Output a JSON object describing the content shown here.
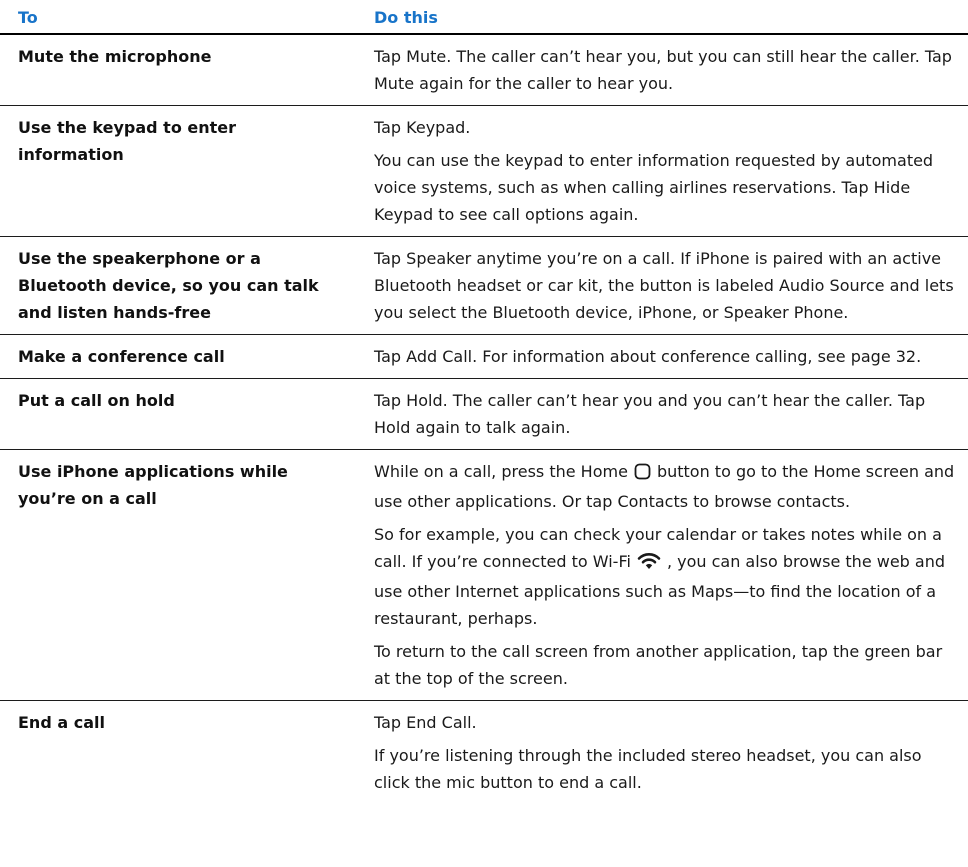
{
  "header": {
    "col_to": "To",
    "col_do": "Do this"
  },
  "rows": [
    {
      "to": "Mute the microphone",
      "do": [
        "Tap Mute. The caller can’t hear you, but you can still hear the caller. Tap Mute again for the caller to hear you."
      ]
    },
    {
      "to": "Use the keypad to enter information",
      "do": [
        "Tap Keypad.",
        "You can use the keypad to enter information requested by automated voice systems, such as when calling airlines reservations. Tap Hide Keypad to see call options again."
      ]
    },
    {
      "to": "Use the speakerphone or a Bluetooth device, so you can talk and listen hands-free",
      "do": [
        "Tap Speaker anytime you’re on a call. If iPhone is paired with an active Bluetooth headset or car kit, the button is labeled Audio Source and lets you select the Bluetooth device, iPhone, or Speaker Phone."
      ]
    },
    {
      "to": "Make a conference call",
      "do": [
        "Tap Add Call. For information about conference calling, see page 32."
      ]
    },
    {
      "to": "Put a call on hold",
      "do": [
        "Tap Hold. The caller can’t hear you and you can’t hear the caller. Tap Hold again to talk again."
      ]
    },
    {
      "to": "Use iPhone applications while you’re on a call",
      "do_p1_a": "While on a call, press the Home",
      "do_p1_b": "button to go to the Home screen and use other applications. Or tap Contacts to browse contacts.",
      "do_p2_a": "So for example, you can check your calendar or takes notes while on a call. If you’re connected to Wi-Fi",
      "do_p2_b": ", you can also browse the web and use other Internet applications such as Maps—to find the location of a restaurant, perhaps.",
      "do_p3": "To return to the call screen from another application, tap the green bar at the top of the screen."
    },
    {
      "to": "End a call",
      "do": [
        "Tap End Call.",
        "If you’re listening through the included stereo headset, you can also click the mic button to end a call."
      ]
    }
  ],
  "icons": {
    "home_button": "home-button-icon",
    "wifi": "wifi-icon"
  },
  "colors": {
    "header_text": "#1874c9",
    "rule": "#000000"
  }
}
